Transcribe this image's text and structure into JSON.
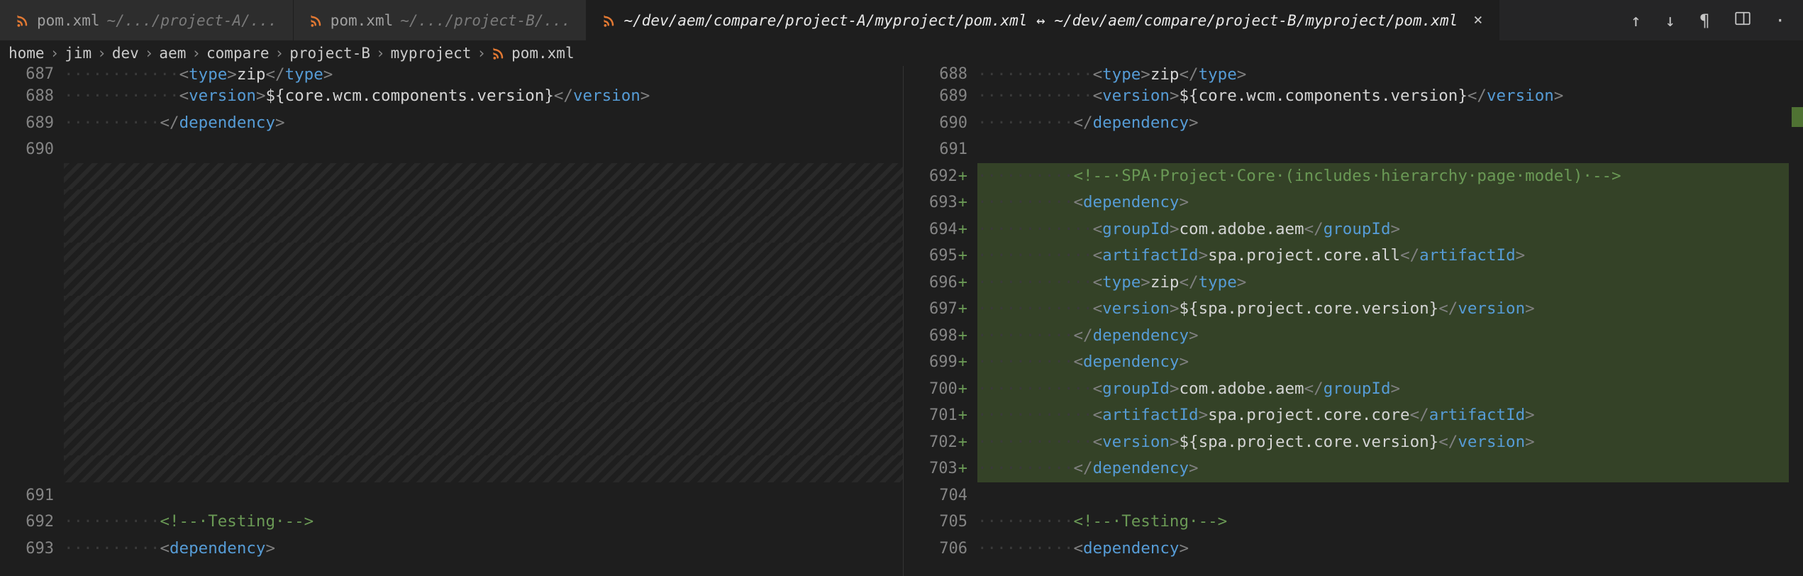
{
  "tabs": [
    {
      "label": "pom.xml",
      "hint": "~/.../project-A/..."
    },
    {
      "label": "pom.xml",
      "hint": "~/.../project-B/..."
    },
    {
      "label": "~/dev/aem/compare/project-A/myproject/pom.xml ↔ ~/dev/aem/compare/project-B/myproject/pom.xml",
      "hint": "",
      "active": true
    }
  ],
  "breadcrumb": [
    "home",
    "jim",
    "dev",
    "aem",
    "compare",
    "project-B",
    "myproject",
    "pom.xml"
  ],
  "left": {
    "lines": [
      {
        "n": "687",
        "first": true,
        "segs": [
          [
            "ws",
            "············"
          ],
          [
            "pun",
            "<"
          ],
          [
            "tagn",
            "type"
          ],
          [
            "pun",
            ">"
          ],
          [
            "txt",
            "zip"
          ],
          [
            "pun",
            "</"
          ],
          [
            "tagn",
            "type"
          ],
          [
            "pun",
            ">"
          ]
        ]
      },
      {
        "n": "688",
        "segs": [
          [
            "ws",
            "············"
          ],
          [
            "pun",
            "<"
          ],
          [
            "tagn",
            "version"
          ],
          [
            "pun",
            ">"
          ],
          [
            "var",
            "${core.wcm.components.version}"
          ],
          [
            "pun",
            "</"
          ],
          [
            "tagn",
            "version"
          ],
          [
            "pun",
            ">"
          ]
        ]
      },
      {
        "n": "689",
        "segs": [
          [
            "ws",
            "··········"
          ],
          [
            "pun",
            "</"
          ],
          [
            "tagn",
            "dependency"
          ],
          [
            "pun",
            ">"
          ]
        ]
      },
      {
        "n": "690",
        "segs": []
      },
      {
        "n": "",
        "hatched": true,
        "segs": []
      },
      {
        "n": "",
        "hatched": true,
        "segs": []
      },
      {
        "n": "",
        "hatched": true,
        "segs": []
      },
      {
        "n": "",
        "hatched": true,
        "segs": []
      },
      {
        "n": "",
        "hatched": true,
        "segs": []
      },
      {
        "n": "",
        "hatched": true,
        "segs": []
      },
      {
        "n": "",
        "hatched": true,
        "segs": []
      },
      {
        "n": "",
        "hatched": true,
        "segs": []
      },
      {
        "n": "",
        "hatched": true,
        "segs": []
      },
      {
        "n": "",
        "hatched": true,
        "segs": []
      },
      {
        "n": "",
        "hatched": true,
        "segs": []
      },
      {
        "n": "",
        "hatched": true,
        "segs": []
      },
      {
        "n": "691",
        "segs": []
      },
      {
        "n": "692",
        "segs": [
          [
            "ws",
            "··········"
          ],
          [
            "cmt",
            "<!--·Testing·-->"
          ]
        ]
      },
      {
        "n": "693",
        "segs": [
          [
            "ws",
            "··········"
          ],
          [
            "pun",
            "<"
          ],
          [
            "tagn",
            "dependency"
          ],
          [
            "pun",
            ">"
          ]
        ]
      }
    ]
  },
  "right": {
    "lines": [
      {
        "n": "688",
        "first": true,
        "segs": [
          [
            "ws",
            "············"
          ],
          [
            "pun",
            "<"
          ],
          [
            "tagn",
            "type"
          ],
          [
            "pun",
            ">"
          ],
          [
            "txt",
            "zip"
          ],
          [
            "pun",
            "</"
          ],
          [
            "tagn",
            "type"
          ],
          [
            "pun",
            ">"
          ]
        ]
      },
      {
        "n": "689",
        "segs": [
          [
            "ws",
            "············"
          ],
          [
            "pun",
            "<"
          ],
          [
            "tagn",
            "version"
          ],
          [
            "pun",
            ">"
          ],
          [
            "var",
            "${core.wcm.components.version}"
          ],
          [
            "pun",
            "</"
          ],
          [
            "tagn",
            "version"
          ],
          [
            "pun",
            ">"
          ]
        ]
      },
      {
        "n": "690",
        "segs": [
          [
            "ws",
            "··········"
          ],
          [
            "pun",
            "</"
          ],
          [
            "tagn",
            "dependency"
          ],
          [
            "pun",
            ">"
          ]
        ]
      },
      {
        "n": "691",
        "segs": []
      },
      {
        "n": "692",
        "mark": "+",
        "added": true,
        "segs": [
          [
            "ws",
            "··········"
          ],
          [
            "cmt",
            "<!--·SPA·Project·Core·(includes·hierarchy·page·model)·-->"
          ]
        ]
      },
      {
        "n": "693",
        "mark": "+",
        "added": true,
        "segs": [
          [
            "ws",
            "··········"
          ],
          [
            "pun",
            "<"
          ],
          [
            "tagn",
            "dependency"
          ],
          [
            "pun",
            ">"
          ]
        ]
      },
      {
        "n": "694",
        "mark": "+",
        "added": true,
        "segs": [
          [
            "ws",
            "············"
          ],
          [
            "pun",
            "<"
          ],
          [
            "tagn",
            "groupId"
          ],
          [
            "pun",
            ">"
          ],
          [
            "txt",
            "com.adobe.aem"
          ],
          [
            "pun",
            "</"
          ],
          [
            "tagn",
            "groupId"
          ],
          [
            "pun",
            ">"
          ]
        ]
      },
      {
        "n": "695",
        "mark": "+",
        "added": true,
        "segs": [
          [
            "ws",
            "············"
          ],
          [
            "pun",
            "<"
          ],
          [
            "tagn",
            "artifactId"
          ],
          [
            "pun",
            ">"
          ],
          [
            "txt",
            "spa.project.core.all"
          ],
          [
            "pun",
            "</"
          ],
          [
            "tagn",
            "artifactId"
          ],
          [
            "pun",
            ">"
          ]
        ]
      },
      {
        "n": "696",
        "mark": "+",
        "added": true,
        "segs": [
          [
            "ws",
            "············"
          ],
          [
            "pun",
            "<"
          ],
          [
            "tagn",
            "type"
          ],
          [
            "pun",
            ">"
          ],
          [
            "txt",
            "zip"
          ],
          [
            "pun",
            "</"
          ],
          [
            "tagn",
            "type"
          ],
          [
            "pun",
            ">"
          ]
        ]
      },
      {
        "n": "697",
        "mark": "+",
        "added": true,
        "segs": [
          [
            "ws",
            "············"
          ],
          [
            "pun",
            "<"
          ],
          [
            "tagn",
            "version"
          ],
          [
            "pun",
            ">"
          ],
          [
            "var",
            "${spa.project.core.version}"
          ],
          [
            "pun",
            "</"
          ],
          [
            "tagn",
            "version"
          ],
          [
            "pun",
            ">"
          ]
        ]
      },
      {
        "n": "698",
        "mark": "+",
        "added": true,
        "segs": [
          [
            "ws",
            "··········"
          ],
          [
            "pun",
            "</"
          ],
          [
            "tagn",
            "dependency"
          ],
          [
            "pun",
            ">"
          ]
        ]
      },
      {
        "n": "699",
        "mark": "+",
        "added": true,
        "segs": [
          [
            "ws",
            "··········"
          ],
          [
            "pun",
            "<"
          ],
          [
            "tagn",
            "dependency"
          ],
          [
            "pun",
            ">"
          ]
        ]
      },
      {
        "n": "700",
        "mark": "+",
        "added": true,
        "segs": [
          [
            "ws",
            "············"
          ],
          [
            "pun",
            "<"
          ],
          [
            "tagn",
            "groupId"
          ],
          [
            "pun",
            ">"
          ],
          [
            "txt",
            "com.adobe.aem"
          ],
          [
            "pun",
            "</"
          ],
          [
            "tagn",
            "groupId"
          ],
          [
            "pun",
            ">"
          ]
        ]
      },
      {
        "n": "701",
        "mark": "+",
        "added": true,
        "segs": [
          [
            "ws",
            "············"
          ],
          [
            "pun",
            "<"
          ],
          [
            "tagn",
            "artifactId"
          ],
          [
            "pun",
            ">"
          ],
          [
            "txt",
            "spa.project.core.core"
          ],
          [
            "pun",
            "</"
          ],
          [
            "tagn",
            "artifactId"
          ],
          [
            "pun",
            ">"
          ]
        ]
      },
      {
        "n": "702",
        "mark": "+",
        "added": true,
        "segs": [
          [
            "ws",
            "············"
          ],
          [
            "pun",
            "<"
          ],
          [
            "tagn",
            "version"
          ],
          [
            "pun",
            ">"
          ],
          [
            "var",
            "${spa.project.core.version}"
          ],
          [
            "pun",
            "</"
          ],
          [
            "tagn",
            "version"
          ],
          [
            "pun",
            ">"
          ]
        ]
      },
      {
        "n": "703",
        "mark": "+",
        "added": true,
        "segs": [
          [
            "ws",
            "··········"
          ],
          [
            "pun",
            "</"
          ],
          [
            "tagn",
            "dependency"
          ],
          [
            "pun",
            ">"
          ]
        ]
      },
      {
        "n": "704",
        "segs": []
      },
      {
        "n": "705",
        "segs": [
          [
            "ws",
            "··········"
          ],
          [
            "cmt",
            "<!--·Testing·-->"
          ]
        ]
      },
      {
        "n": "706",
        "segs": [
          [
            "ws",
            "··········"
          ],
          [
            "pun",
            "<"
          ],
          [
            "tagn",
            "dependency"
          ],
          [
            "pun",
            ">"
          ]
        ]
      }
    ]
  }
}
